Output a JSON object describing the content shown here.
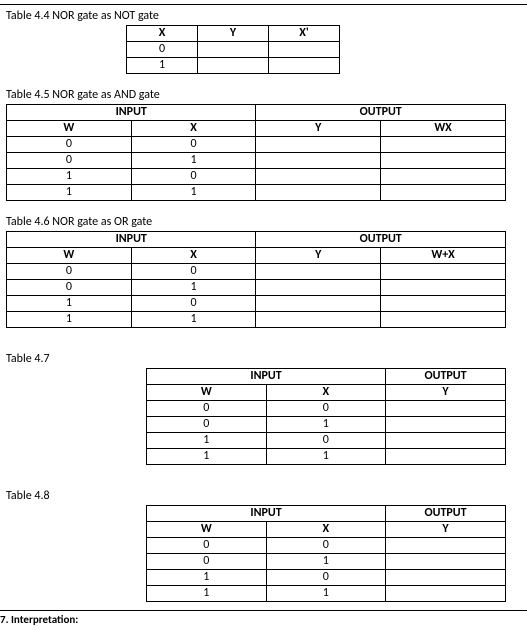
{
  "t44": {
    "caption": "Table 4.4 NOR gate as NOT gate",
    "headers": [
      "X",
      "Y",
      "X'"
    ],
    "rows": [
      [
        "0",
        "",
        ""
      ],
      [
        "1",
        "",
        ""
      ]
    ]
  },
  "t45": {
    "caption": "Table 4.5 NOR gate as AND gate",
    "group_headers": [
      "INPUT",
      "OUTPUT"
    ],
    "headers": [
      "W",
      "X",
      "Y",
      "WX"
    ],
    "rows": [
      [
        "0",
        "0",
        "",
        ""
      ],
      [
        "0",
        "1",
        "",
        ""
      ],
      [
        "1",
        "0",
        "",
        ""
      ],
      [
        "1",
        "1",
        "",
        ""
      ]
    ]
  },
  "t46": {
    "caption": "Table 4.6 NOR gate as OR gate",
    "group_headers": [
      "INPUT",
      "OUTPUT"
    ],
    "headers": [
      "W",
      "X",
      "Y",
      "W+X"
    ],
    "rows": [
      [
        "0",
        "0",
        "",
        ""
      ],
      [
        "0",
        "1",
        "",
        ""
      ],
      [
        "1",
        "0",
        "",
        ""
      ],
      [
        "1",
        "1",
        "",
        ""
      ]
    ]
  },
  "t47": {
    "caption": "Table 4.7",
    "group_headers": [
      "INPUT",
      "OUTPUT"
    ],
    "headers": [
      "W",
      "X",
      "Y"
    ],
    "rows": [
      [
        "0",
        "0",
        ""
      ],
      [
        "0",
        "1",
        ""
      ],
      [
        "1",
        "0",
        ""
      ],
      [
        "1",
        "1",
        ""
      ]
    ]
  },
  "t48": {
    "caption": "Table 4.8",
    "group_headers": [
      "INPUT",
      "OUTPUT"
    ],
    "headers": [
      "W",
      "X",
      "Y"
    ],
    "rows": [
      [
        "0",
        "0",
        ""
      ],
      [
        "0",
        "1",
        ""
      ],
      [
        "1",
        "0",
        ""
      ],
      [
        "1",
        "1",
        ""
      ]
    ]
  },
  "footer_cut": "7. Interpretation:"
}
